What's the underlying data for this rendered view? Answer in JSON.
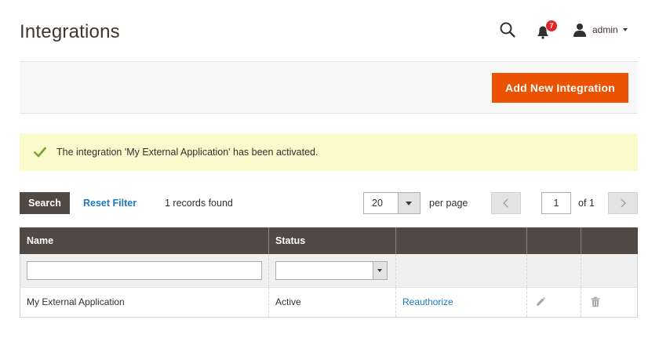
{
  "page": {
    "title": "Integrations"
  },
  "header": {
    "notifications_count": "7",
    "user_name": "admin"
  },
  "actions": {
    "add_new_label": "Add New Integration"
  },
  "message": {
    "text": "The integration 'My External Application' has been activated."
  },
  "toolbar": {
    "search_label": "Search",
    "reset_filter_label": "Reset Filter",
    "records_found": "1 records found",
    "per_page_value": "20",
    "per_page_label": "per page",
    "current_page": "1",
    "total_pages": "of 1"
  },
  "grid": {
    "columns": [
      "Name",
      "Status",
      "",
      "",
      ""
    ],
    "rows": [
      {
        "name": "My External Application",
        "status": "Active",
        "action": "Reauthorize"
      }
    ]
  },
  "colors": {
    "accent": "#eb5202",
    "header_dark": "#514943",
    "link": "#1979c3",
    "success": "#79a22e",
    "message_bg": "#fafacc",
    "badge": "#e22626"
  },
  "icons": [
    "search-icon",
    "bell-icon",
    "user-icon",
    "checkmark-icon",
    "edit-icon",
    "trash-icon",
    "chevron-left-icon",
    "chevron-right-icon"
  ]
}
